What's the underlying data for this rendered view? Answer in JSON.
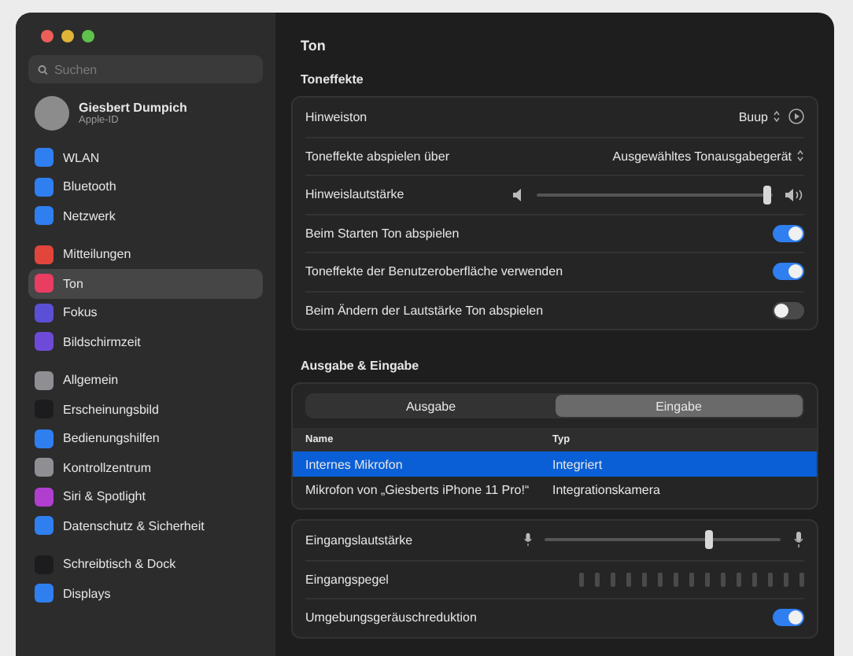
{
  "window": {
    "title": "Ton"
  },
  "sidebar": {
    "search": {
      "placeholder": "Suchen"
    },
    "account": {
      "name": "Giesbert Dumpich",
      "subtitle": "Apple-ID"
    },
    "groups": [
      [
        {
          "label": "WLAN",
          "color": "#2f7ff0",
          "selected": false
        },
        {
          "label": "Bluetooth",
          "color": "#2f7ff0",
          "selected": false
        },
        {
          "label": "Netzwerk",
          "color": "#2f7ff0",
          "selected": false
        }
      ],
      [
        {
          "label": "Mitteilungen",
          "color": "#e2453c",
          "selected": false
        },
        {
          "label": "Ton",
          "color": "#e93d62",
          "selected": true
        },
        {
          "label": "Fokus",
          "color": "#5b4fd6",
          "selected": false
        },
        {
          "label": "Bildschirmzeit",
          "color": "#6d4bd8",
          "selected": false
        }
      ],
      [
        {
          "label": "Allgemein",
          "color": "#8e8e93",
          "selected": false
        },
        {
          "label": "Erscheinungsbild",
          "color": "#1c1c1e",
          "selected": false
        },
        {
          "label": "Bedienungshilfen",
          "color": "#2f7ff0",
          "selected": false
        },
        {
          "label": "Kontrollzentrum",
          "color": "#8e8e93",
          "selected": false
        },
        {
          "label": "Siri & Spotlight",
          "color": "#b03fd0",
          "selected": false
        },
        {
          "label": "Datenschutz & Sicherheit",
          "color": "#2f7ff0",
          "selected": false
        }
      ],
      [
        {
          "label": "Schreibtisch & Dock",
          "color": "#1c1c1e",
          "selected": false
        },
        {
          "label": "Displays",
          "color": "#2f7ff0",
          "selected": false
        }
      ]
    ]
  },
  "sound_effects": {
    "heading": "Toneffekte",
    "rows": [
      {
        "kind": "popup",
        "label": "Hinweiston",
        "value": "Buup",
        "play": true
      },
      {
        "kind": "popup",
        "label": "Toneffekte abspielen über",
        "value": "Ausgewähltes Tonausgabegerät"
      },
      {
        "kind": "slider",
        "label": "Hinweislautstärke",
        "level": 0.97
      },
      {
        "kind": "toggle",
        "label": "Beim Starten Ton abspielen",
        "on": true
      },
      {
        "kind": "toggle",
        "label": "Toneffekte der Benutzeroberfläche verwenden",
        "on": true
      },
      {
        "kind": "toggle",
        "label": "Beim Ändern der Lautstärke Ton abspielen",
        "on": false
      }
    ]
  },
  "output_input": {
    "heading": "Ausgabe & Eingabe",
    "tabs": [
      {
        "label": "Ausgabe",
        "selected": false
      },
      {
        "label": "Eingabe",
        "selected": true
      }
    ],
    "table": {
      "columns": [
        "Name",
        "Typ"
      ],
      "rows": [
        {
          "cells": [
            "Internes Mikrofon",
            "Integriert"
          ],
          "selected": true
        },
        {
          "cells": [
            "Mikrofon von „Giesberts iPhone 11 Pro!“",
            "Integrationskamera"
          ],
          "selected": false
        }
      ]
    },
    "rows": [
      {
        "kind": "slider",
        "label": "Eingangslautstärke",
        "level": 0.69
      },
      {
        "kind": "meter",
        "label": "Eingangspegel"
      },
      {
        "kind": "toggle",
        "label": "Umgebungsgeräuschreduktion",
        "on": true
      }
    ]
  }
}
